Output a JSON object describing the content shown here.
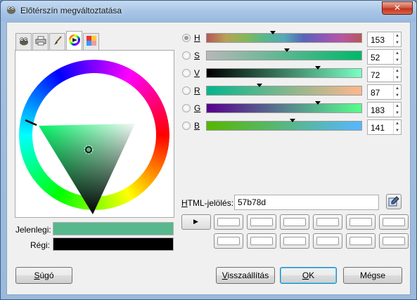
{
  "window": {
    "title": "Előtérszín megváltoztatása",
    "close_label": "✕"
  },
  "tabs": [
    {
      "icon": "gimp-wilber-icon"
    },
    {
      "icon": "printer-icon"
    },
    {
      "icon": "brush-icon"
    },
    {
      "icon": "color-wheel-icon",
      "active": true
    },
    {
      "icon": "palette-icon"
    }
  ],
  "swatches": {
    "current_label": "Jelenlegi:",
    "current_color": "#57b78d",
    "old_label": "Régi:",
    "old_color": "#000000"
  },
  "sliders": [
    {
      "key": "H",
      "value": "153",
      "level": 0.425,
      "checked": true,
      "gradient": "linear-gradient(90deg,#b75757,#b7a257,#85b757,#57b78d,#57a9b7,#5765b7,#8d57b7,#b757a2,#b75757)"
    },
    {
      "key": "S",
      "value": "52",
      "level": 0.52,
      "checked": false,
      "gradient": "linear-gradient(90deg,#b7b7b7,#00b76a)"
    },
    {
      "key": "V",
      "value": "72",
      "level": 0.72,
      "checked": false,
      "gradient": "linear-gradient(90deg,#000000,#57b78d 72%,#7affc4)"
    },
    {
      "key": "R",
      "value": "87",
      "level": 0.341,
      "checked": false,
      "gradient": "linear-gradient(90deg,#00b78d,#ffb78d)"
    },
    {
      "key": "G",
      "value": "183",
      "level": 0.718,
      "checked": false,
      "gradient": "linear-gradient(90deg,#57008d,#57ff8d)"
    },
    {
      "key": "B",
      "value": "141",
      "level": 0.553,
      "checked": false,
      "gradient": "linear-gradient(90deg,#57b700,#57b7ff)"
    }
  ],
  "hex": {
    "label_prefix": "H",
    "label_rest": "TML-jelölés:",
    "value": "57b78d"
  },
  "buttons": {
    "help_prefix": "S",
    "help_rest": "úgó",
    "reset_prefix": "V",
    "reset_rest": "isszaállítás",
    "ok_prefix": "O",
    "ok_rest": "K",
    "cancel": "Mégse",
    "play_icon": "▶"
  }
}
